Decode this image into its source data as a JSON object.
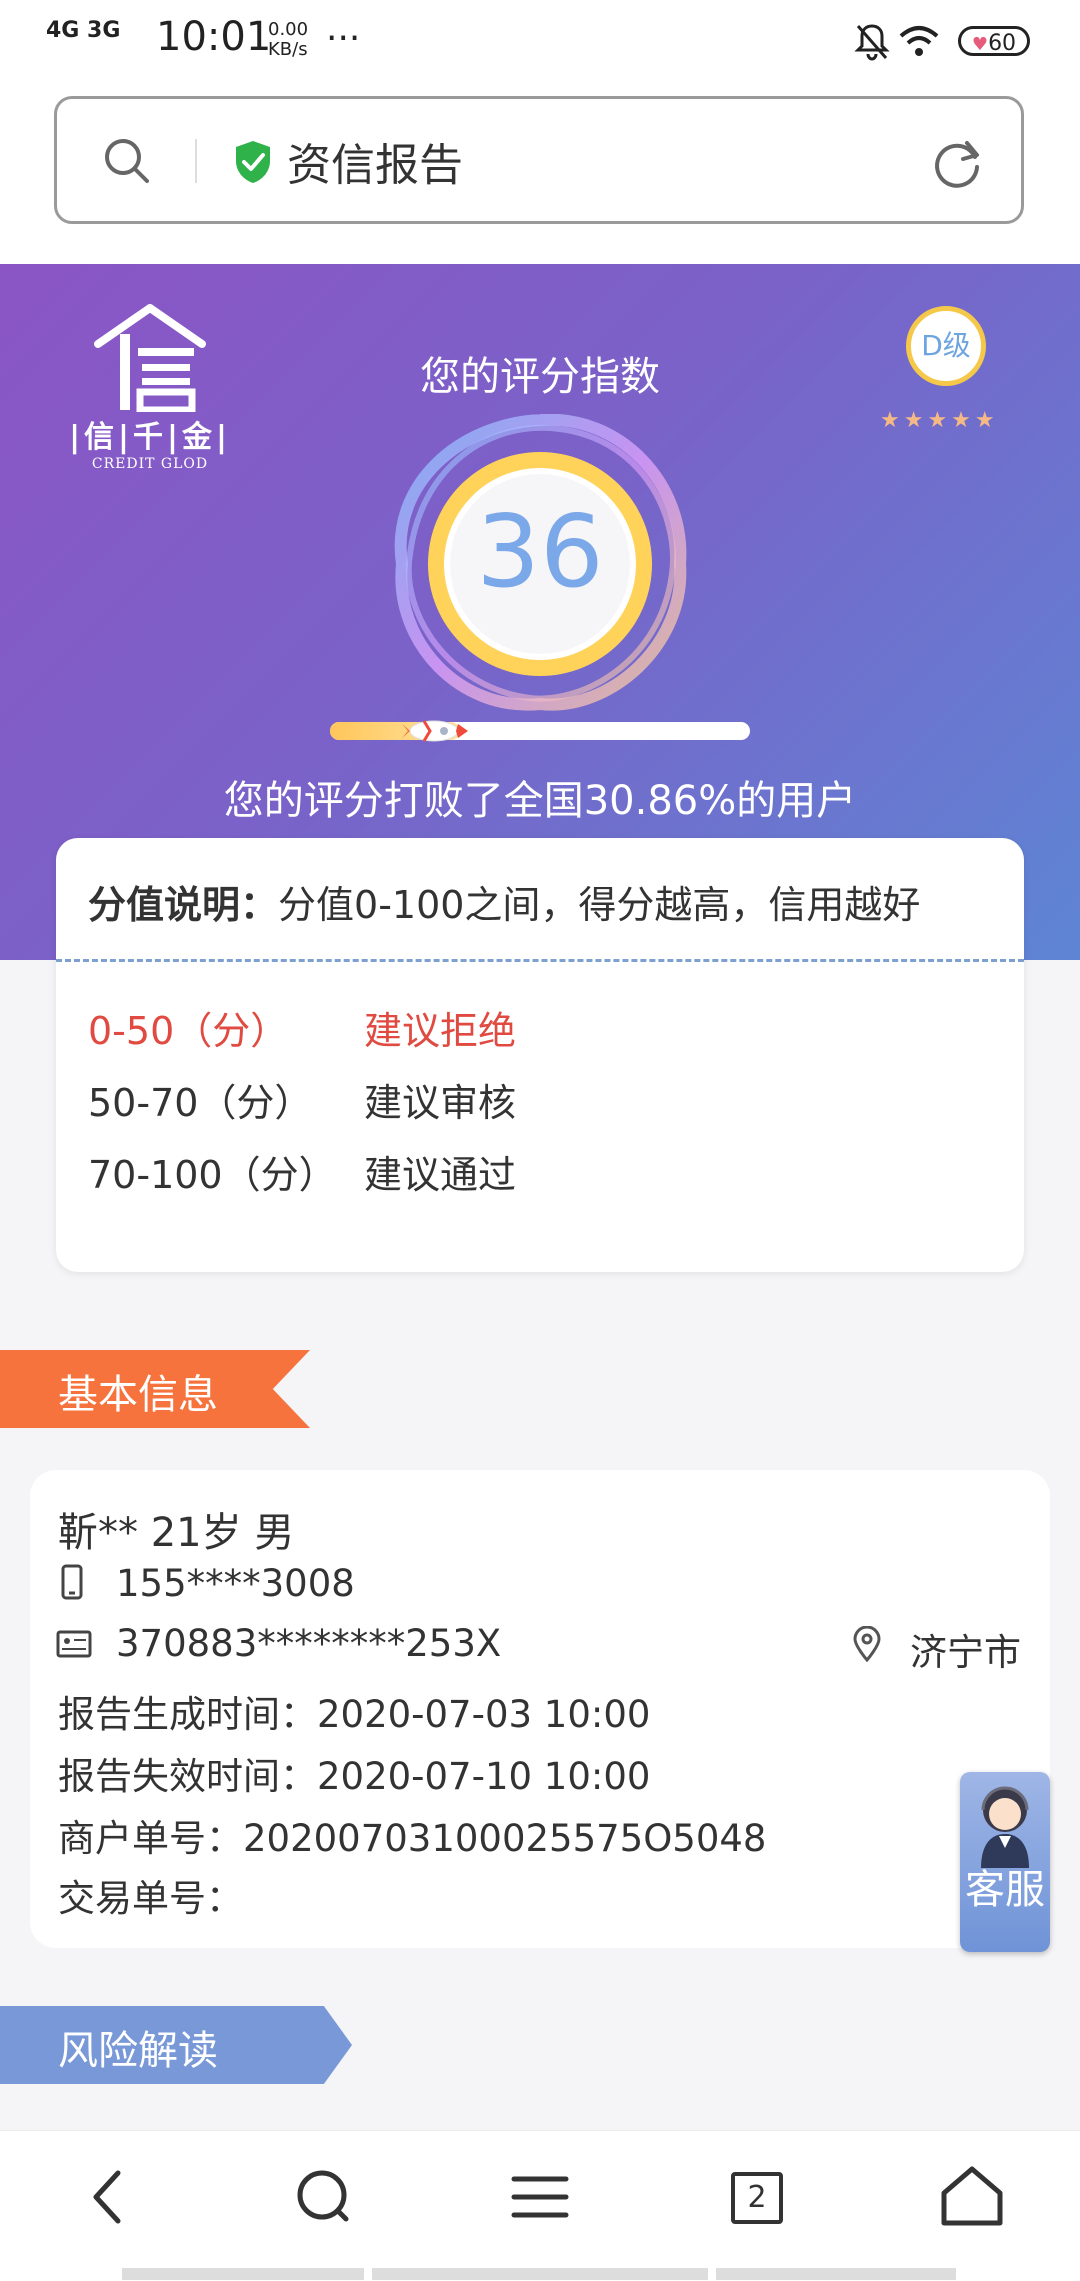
{
  "status_bar": {
    "network": "4G 3G",
    "time": "10:01",
    "speed_value": "0.00",
    "speed_unit": "KB/s",
    "more": "···",
    "battery": "60"
  },
  "address_bar": {
    "title": "资信报告"
  },
  "hero": {
    "title": "您的评分指数",
    "logo_text": "|信|千|金|",
    "logo_sub": "CREDIT GLOD",
    "grade": "D级",
    "stars": "★★★★★",
    "score": "36",
    "progress_fraction": 0.3086,
    "beat_text": "您的评分打败了全国30.86%的用户"
  },
  "explanation": {
    "label": "分值说明：",
    "text": "分值0-100之间，得分越高，信用越好",
    "rows": [
      {
        "range": "0-50（分）",
        "advice": "建议拒绝",
        "color": "#e04a40"
      },
      {
        "range": "50-70（分）",
        "advice": "建议审核",
        "color": "#333333"
      },
      {
        "range": "70-100（分）",
        "advice": "建议通过",
        "color": "#333333"
      }
    ]
  },
  "basic_info": {
    "section_title": "基本信息",
    "name_line": "靳**    21岁   男",
    "phone": "155****3008",
    "id_number": "370883********253X",
    "city": "济宁市",
    "generated_label": "报告生成时间：",
    "generated_value": "2020-07-03 10:00",
    "expire_label": "报告失效时间：",
    "expire_value": "2020-07-10 10:00",
    "merchant_label": "商户单号：",
    "merchant_value": "20200703100025575O5048",
    "trade_label": "交易单号：",
    "trade_value": ""
  },
  "service_button": {
    "label": "客服"
  },
  "risk": {
    "section_title": "风险解读"
  },
  "bottom_nav": {
    "tabs_count": "2"
  }
}
